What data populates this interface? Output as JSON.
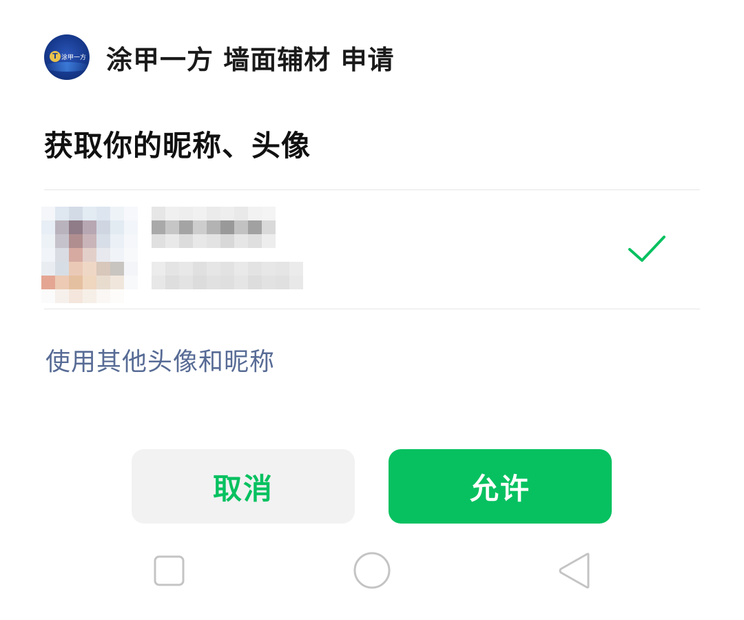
{
  "app": {
    "logo_text": "涂甲一方",
    "logo_initial": "T",
    "title": "涂甲一方 墙面辅材 申请"
  },
  "dialog": {
    "heading": "获取你的昵称、头像"
  },
  "profile": {
    "selected": true
  },
  "other_link": "使用其他头像和昵称",
  "buttons": {
    "cancel": "取消",
    "allow": "允许"
  },
  "colors": {
    "accent_green": "#07c160",
    "link_blue": "#576b95",
    "cancel_bg": "#f2f2f2"
  },
  "icons": {
    "check": "check-icon",
    "nav_recent": "square-icon",
    "nav_home": "circle-icon",
    "nav_back": "triangle-back-icon"
  }
}
